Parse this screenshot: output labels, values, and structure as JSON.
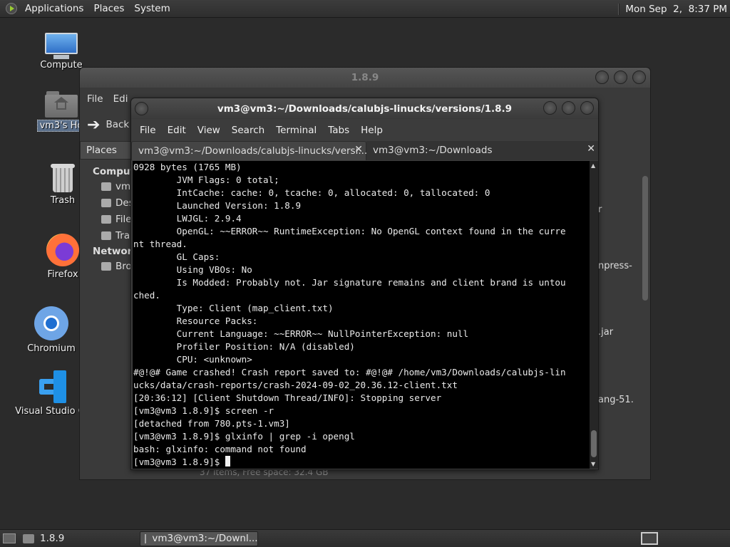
{
  "top_panel": {
    "menus": [
      "Applications",
      "Places",
      "System"
    ],
    "clock": "Mon Sep  2,  8:37 PM"
  },
  "desktop_icons": [
    {
      "label": "Compute",
      "icon": "computer-icon"
    },
    {
      "label": "vm3's Ho",
      "icon": "home-folder-icon"
    },
    {
      "label": "Trash",
      "icon": "trash-icon"
    },
    {
      "label": "Firefox",
      "icon": "firefox-icon"
    },
    {
      "label": "Chromium",
      "icon": "chromium-icon"
    },
    {
      "label": "Visual Studio Co",
      "icon": "vscode-icon"
    }
  ],
  "file_manager": {
    "title": "1.8.9",
    "menus": [
      "File",
      "Edi"
    ],
    "back_label": "Back",
    "places_label": "Places",
    "sidebar": {
      "computer_header": "Compute",
      "computer_items": [
        "vm",
        "Des",
        "File",
        "Tra"
      ],
      "network_header": "Network",
      "network_items": [
        "Bro"
      ]
    },
    "content_fragments": [
      "r",
      "npress-",
      ".jar",
      "ang-51."
    ],
    "status": "37 items, Free space: 32.4 GB"
  },
  "terminal": {
    "title": "vm3@vm3:~/Downloads/calubjs-linucks/versions/1.8.9",
    "menus": [
      "File",
      "Edit",
      "View",
      "Search",
      "Terminal",
      "Tabs",
      "Help"
    ],
    "tabs": [
      {
        "label": "vm3@vm3:~/Downloads/calubjs-linucks/versi...",
        "active": true
      },
      {
        "label": "vm3@vm3:~/Downloads",
        "active": false
      }
    ],
    "lines": [
      "0928 bytes (1765 MB)",
      "        JVM Flags: 0 total;",
      "        IntCache: cache: 0, tcache: 0, allocated: 0, tallocated: 0",
      "        Launched Version: 1.8.9",
      "        LWJGL: 2.9.4",
      "        OpenGL: ~~ERROR~~ RuntimeException: No OpenGL context found in the curre",
      "nt thread.",
      "        GL Caps:",
      "        Using VBOs: No",
      "        Is Modded: Probably not. Jar signature remains and client brand is untou",
      "ched.",
      "        Type: Client (map_client.txt)",
      "        Resource Packs:",
      "        Current Language: ~~ERROR~~ NullPointerException: null",
      "        Profiler Position: N/A (disabled)",
      "        CPU: <unknown>",
      "#@!@# Game crashed! Crash report saved to: #@!@# /home/vm3/Downloads/calubjs-lin",
      "ucks/data/crash-reports/crash-2024-09-02_20.36.12-client.txt",
      "[20:36:12] [Client Shutdown Thread/INFO]: Stopping server",
      "[vm3@vm3 1.8.9]$ screen -r",
      "[detached from 780.pts-1.vm3]",
      "[vm3@vm3 1.8.9]$ glxinfo | grep -i opengl",
      "bash: glxinfo: command not found"
    ],
    "prompt": "[vm3@vm3 1.8.9]$ "
  },
  "bottom_panel": {
    "tasks": [
      {
        "label": "1.8.9",
        "icon": "folder-icon"
      },
      {
        "label": "vm3@vm3:~/Downl...",
        "icon": "terminal-icon"
      }
    ]
  }
}
